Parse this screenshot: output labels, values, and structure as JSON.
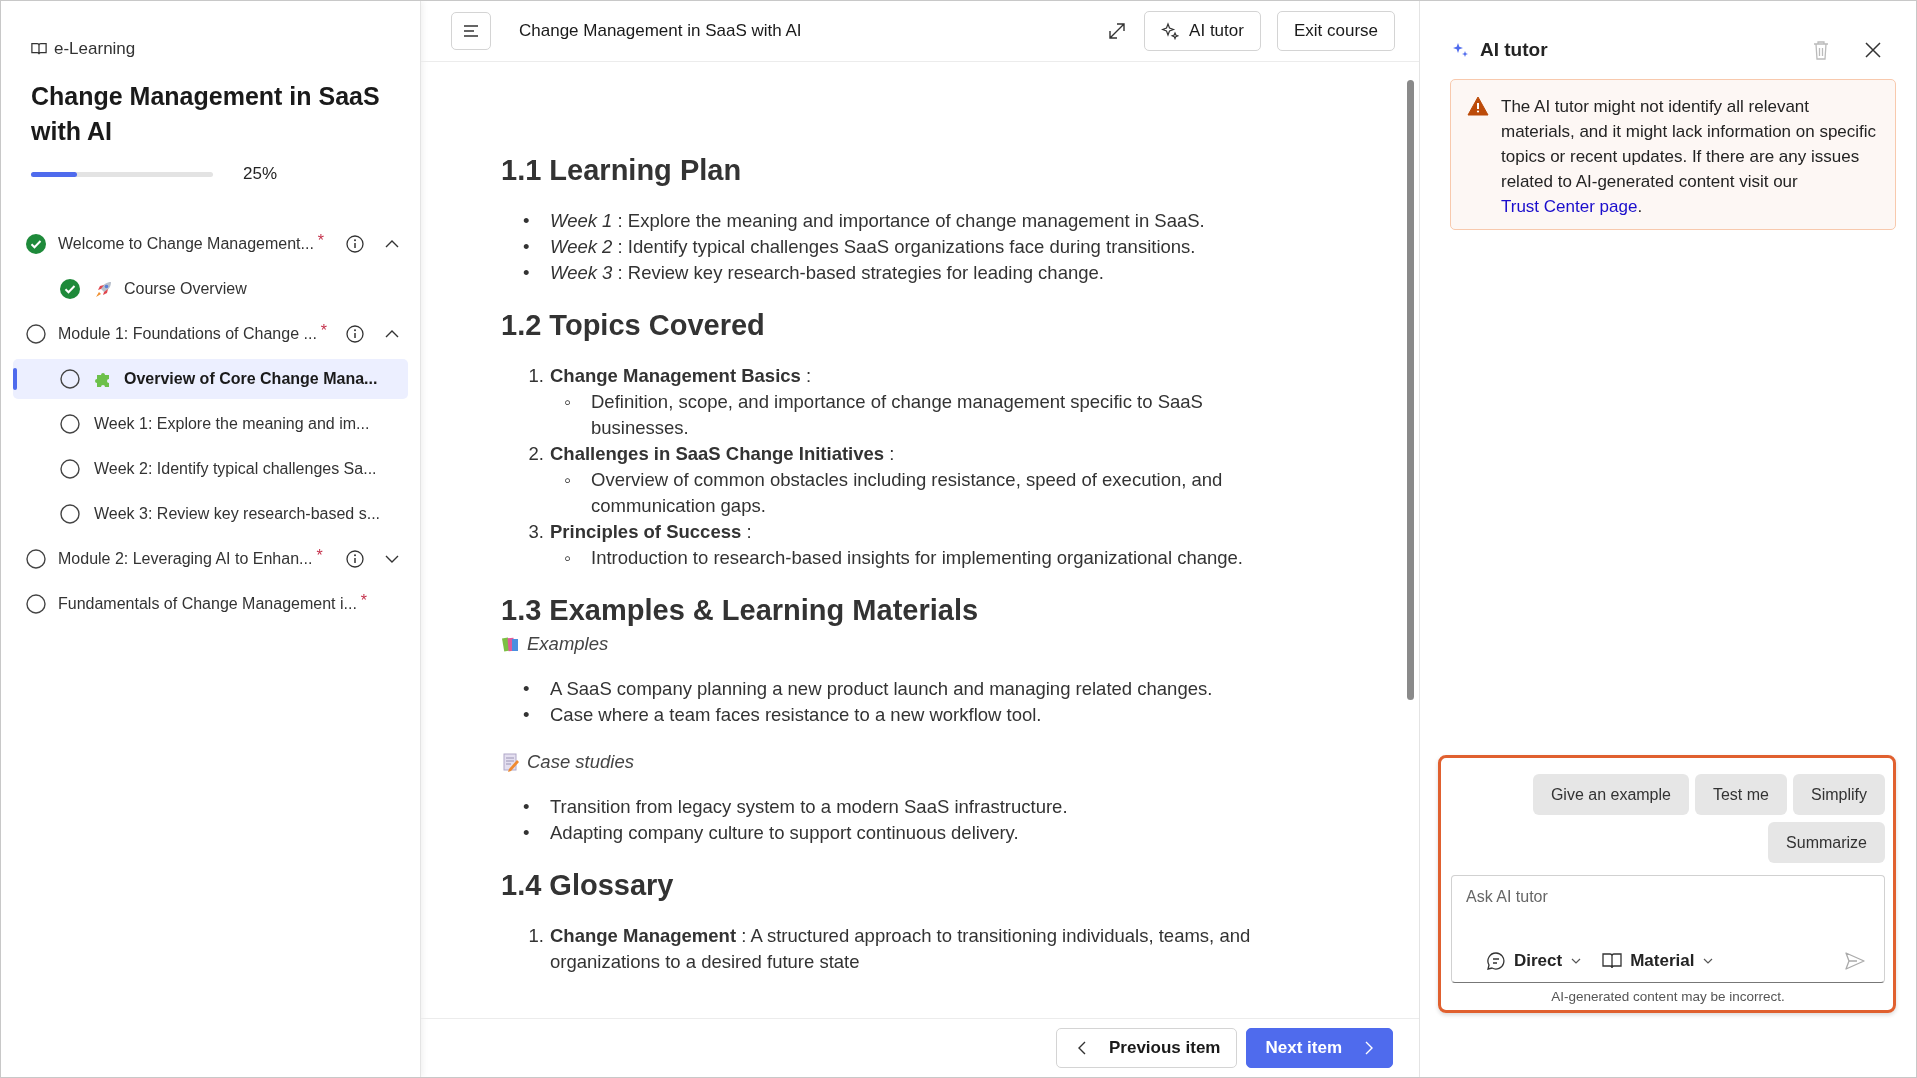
{
  "sidebar": {
    "app_label": "e-Learning",
    "course_title": "Change Management in SaaS with AI",
    "progress": {
      "level": 0.25,
      "reading": "25%"
    },
    "items": [
      {
        "kind": "module",
        "label": "Welcome to Change Management...",
        "required_mark": "*",
        "done": true,
        "selected": false,
        "expanded": true,
        "children": [
          {
            "kind": "rocket",
            "label": "Course Overview",
            "done": true,
            "selected": false
          }
        ]
      },
      {
        "kind": "module",
        "label": "Module 1: Foundations of Change ...",
        "required_mark": "*",
        "done": false,
        "selected": false,
        "expanded": true,
        "children": [
          {
            "kind": "puzzle",
            "label": "Overview of Core Change Mana...",
            "done": false,
            "selected": true
          },
          {
            "kind": "plain",
            "label": "Week 1: Explore the meaning and im...",
            "done": false,
            "selected": false
          },
          {
            "kind": "plain",
            "label": "Week 2: Identify typical challenges Sa...",
            "done": false,
            "selected": false
          },
          {
            "kind": "plain",
            "label": "Week 3: Review key research-based s...",
            "done": false,
            "selected": false
          }
        ]
      },
      {
        "kind": "module",
        "label": "Module 2: Leveraging AI to Enhan...",
        "required_mark": "*",
        "done": false,
        "selected": false,
        "expanded": false
      },
      {
        "kind": "lesson",
        "label": "Fundamentals of Change Management i...",
        "required_mark": "*",
        "done": false,
        "selected": false
      }
    ]
  },
  "header": {
    "title": "Change Management in SaaS with AI",
    "buttons": [
      "AI tutor",
      "Exit course"
    ]
  },
  "content": {
    "sections": [
      {
        "heading": "1.1 Learning Plan",
        "blocks": [
          {
            "kind": "bullets",
            "items": [
              {
                "marker": "•",
                "text": "*Week 1* : Explore the meaning and importance of change management in SaaS."
              },
              {
                "marker": "•",
                "text": "*Week 2* : Identify typical challenges SaaS organizations face during transitions."
              },
              {
                "marker": "•",
                "text": "*Week 3* : Review key research-based strategies for leading change."
              }
            ]
          }
        ]
      },
      {
        "heading": "1.2 Topics Covered",
        "blocks": [
          {
            "kind": "numbered",
            "items": [
              {
                "marker": "1.",
                "text": "**Change Management Basics** :",
                "sub": [
                  {
                    "marker": "◦",
                    "text": "Definition, scope, and importance of change management specific to SaaS businesses."
                  }
                ]
              },
              {
                "marker": "2.",
                "text": "**Challenges in SaaS Change Initiatives** :",
                "sub": [
                  {
                    "marker": "◦",
                    "text": "Overview of common obstacles including resistance, speed of execution, and communication gaps."
                  }
                ]
              },
              {
                "marker": "3.",
                "text": "**Principles of Success** :",
                "sub": [
                  {
                    "marker": "◦",
                    "text": "Introduction to research-based insights for implementing organizational change."
                  }
                ]
              }
            ]
          }
        ]
      },
      {
        "heading": "1.3 Examples & Learning Materials",
        "blocks": [
          {
            "kind": "books_caption",
            "text": "Examples"
          },
          {
            "kind": "bullets",
            "items": [
              {
                "marker": "•",
                "text": "A SaaS company planning a new product launch and managing related changes."
              },
              {
                "marker": "•",
                "text": "Case where a team faces resistance to a new workflow tool."
              }
            ]
          },
          {
            "kind": "memo_caption",
            "text": "Case studies"
          },
          {
            "kind": "bullets",
            "items": [
              {
                "marker": "•",
                "text": "Transition from legacy system to a modern SaaS infrastructure."
              },
              {
                "marker": "•",
                "text": "Adapting company culture to support continuous delivery."
              }
            ]
          }
        ]
      },
      {
        "heading": "1.4 Glossary",
        "blocks": [
          {
            "kind": "numbered",
            "items": [
              {
                "marker": "1.",
                "text": "**Change Management** : A structured approach to transitioning individuals, teams, and organizations to a desired future state"
              }
            ]
          }
        ]
      }
    ]
  },
  "footer": {
    "previous": "Previous item",
    "next": "Next item"
  },
  "tutor": {
    "title": "AI tutor",
    "notice": {
      "text": "The AI tutor might not identify all relevant materials, and it might lack information on specific topics or recent updates. If there are any issues related to AI-generated content visit our",
      "link": "Trust Center page",
      "tail": "."
    },
    "suggestions": [
      "Give an example",
      "Test me",
      "Simplify",
      "Summarize"
    ],
    "input": {
      "placeholder": "Ask AI tutor"
    },
    "modes": [
      "Direct",
      "Material"
    ],
    "disclaimer": "AI-generated content may be incorrect."
  }
}
